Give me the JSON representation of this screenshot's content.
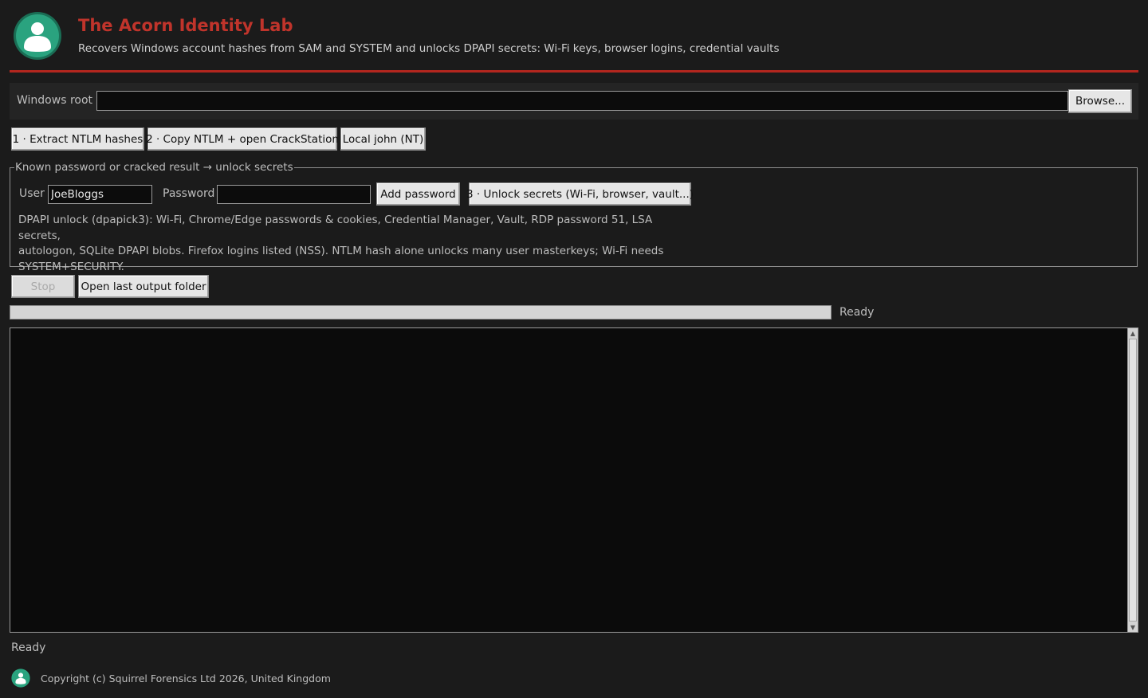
{
  "header": {
    "title": "The Acorn Identity Lab",
    "subtitle": "Recovers Windows account hashes from SAM and SYSTEM and unlocks DPAPI secrets: Wi-Fi keys, browser logins, credential vaults",
    "logo_icon": "user-avatar-icon",
    "accent_color": "#c0342b",
    "logo_color": "#2aa37f"
  },
  "root_row": {
    "label": "Windows root",
    "value": "",
    "browse_label": "Browse..."
  },
  "actions": {
    "extract_label": "1 · Extract NTLM hashes",
    "copy_label": "2 · Copy NTLM + open CrackStation",
    "john_label": "Local john (NT)"
  },
  "unlock_group": {
    "legend": "Known password or cracked result → unlock secrets",
    "user_label": "User",
    "user_value": "JoeBloggs",
    "password_label": "Password",
    "password_value": "",
    "add_password_label": "Add password",
    "unlock_label": "3 · Unlock secrets (Wi-Fi, browser, vault...)",
    "info_lines": [
      "DPAPI unlock (dpapick3): Wi-Fi, Chrome/Edge passwords & cookies, Credential Manager, Vault, RDP password 51, LSA secrets,",
      "autologon, SQLite DPAPI blobs. Firefox logins listed (NSS). NTLM hash alone unlocks many user masterkeys; Wi-Fi needs",
      "SYSTEM+SECURITY."
    ]
  },
  "controls": {
    "stop_label": "Stop",
    "open_folder_label": "Open last output folder"
  },
  "progress": {
    "value": 0,
    "status": "Ready"
  },
  "log": {
    "content": ""
  },
  "status_bar": {
    "text": "Ready"
  },
  "footer": {
    "copyright": "Copyright (c) Squirrel Forensics Ltd 2026, United Kingdom",
    "logo_icon": "user-avatar-icon"
  }
}
